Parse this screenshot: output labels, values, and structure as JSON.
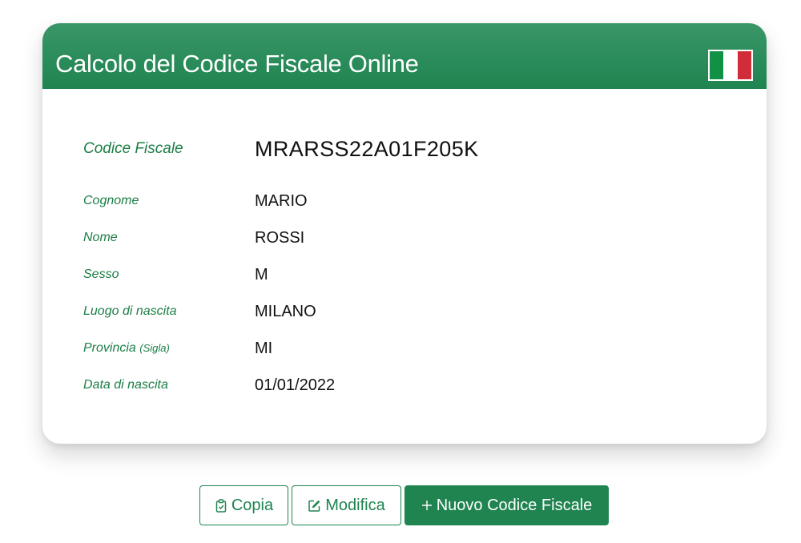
{
  "header": {
    "title": "Calcolo del Codice Fiscale Online",
    "flag_colors": [
      "#119146",
      "#ffffff",
      "#d12d38"
    ]
  },
  "result": {
    "codice_fiscale": {
      "label": "Codice Fiscale",
      "value": "MRARSS22A01F205K"
    },
    "fields": [
      {
        "label": "Cognome",
        "value": "MARIO"
      },
      {
        "label": "Nome",
        "value": "ROSSI"
      },
      {
        "label": "Sesso",
        "value": "M"
      },
      {
        "label": "Luogo di nascita",
        "value": "MILANO"
      },
      {
        "label": "Provincia",
        "label_note": "(Sigla)",
        "value": "MI"
      },
      {
        "label": "Data di nascita",
        "value": "01/01/2022"
      }
    ]
  },
  "actions": {
    "copy": {
      "label": "Copia",
      "icon": "clipboard-icon"
    },
    "edit": {
      "label": "Modifica",
      "icon": "edit-icon"
    },
    "new": {
      "label": "Nuovo Codice Fiscale",
      "icon": "plus-icon"
    }
  },
  "colors": {
    "accent": "#1f8450",
    "label": "#1a7d44"
  }
}
